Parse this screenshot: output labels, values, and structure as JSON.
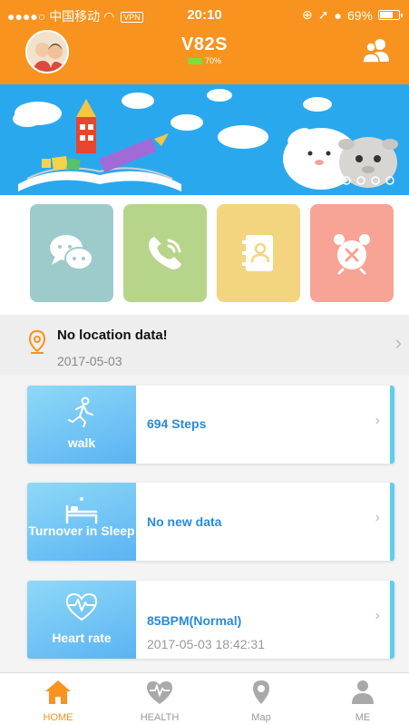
{
  "status_bar": {
    "carrier": "●●●●○ 中国移动",
    "vpn": "VPN",
    "time": "20:10",
    "battery_percent": "69%"
  },
  "header": {
    "device_name": "V82S",
    "device_battery": "70%"
  },
  "colors": {
    "accent": "#f7931e",
    "tile_chat": "#9dcbcc",
    "tile_call": "#b7d58a",
    "tile_contacts": "#f3d57f",
    "tile_alarm": "#f7a395",
    "card_value": "#2a8ad8"
  },
  "quick_actions": [
    {
      "name": "chat",
      "icon": "chat-bubbles-icon"
    },
    {
      "name": "call",
      "icon": "phone-call-icon"
    },
    {
      "name": "contacts",
      "icon": "address-book-icon"
    },
    {
      "name": "alarm",
      "icon": "alarm-clock-icon"
    }
  ],
  "location": {
    "title": "No location data!",
    "date": "2017-05-03"
  },
  "cards": [
    {
      "label": "walk",
      "value": "694 Steps",
      "icon": "running-person-icon"
    },
    {
      "label": "Turnover in Sleep",
      "value": "No new data",
      "icon": "bed-icon"
    },
    {
      "label": "Heart rate",
      "value": "85BPM(Normal)",
      "subtext": "2017-05-03 18:42:31",
      "icon": "heart-pulse-icon"
    }
  ],
  "tabs": [
    {
      "label": "HOME",
      "active": true,
      "icon": "home-icon"
    },
    {
      "label": "HEALTH",
      "active": false,
      "icon": "heart-pulse-icon"
    },
    {
      "label": "Map",
      "active": false,
      "icon": "map-pin-icon"
    },
    {
      "label": "ME",
      "active": false,
      "icon": "person-icon"
    }
  ]
}
